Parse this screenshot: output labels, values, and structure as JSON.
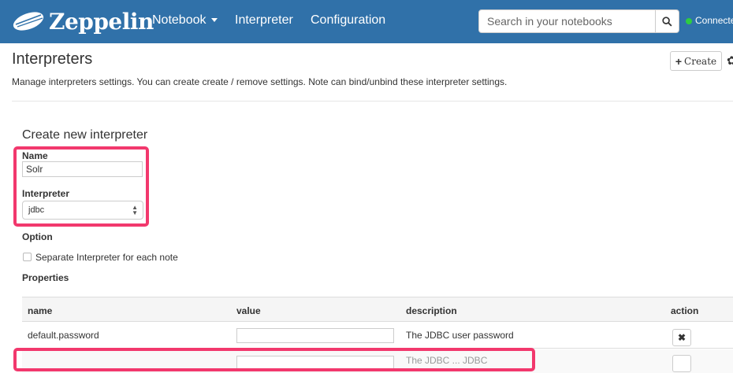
{
  "navbar": {
    "brand": "Zeppelin",
    "links": [
      "Notebook",
      "Interpreter",
      "Configuration"
    ],
    "search_placeholder": "Search in your notebooks",
    "status": "Connected",
    "colors": {
      "bar": "#3071a9",
      "status_dot": "#2ecc40"
    }
  },
  "header": {
    "title": "Interpreters",
    "description": "Manage interpreters settings. You can create create / remove settings. Note can bind/unbind these interpreter settings.",
    "create_label": "Create"
  },
  "form": {
    "section_title": "Create new interpreter",
    "name_label": "Name",
    "name_value": "Solr",
    "interpreter_label": "Interpreter",
    "interpreter_value": "jdbc",
    "option_label": "Option",
    "separate_label": "Separate Interpreter for each note",
    "properties_label": "Properties",
    "highlight_color": "#f2386d"
  },
  "properties_table": {
    "headers": [
      "name",
      "value",
      "description",
      "action"
    ],
    "rows": [
      {
        "name": "default.password",
        "value": "",
        "description": "The JDBC user password"
      }
    ],
    "partial_row_description": "The JDBC ... JDBC"
  }
}
